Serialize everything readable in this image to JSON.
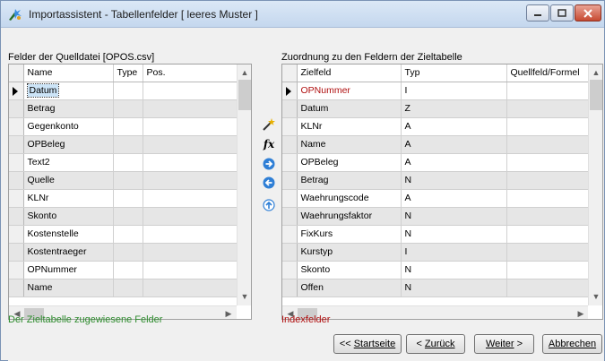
{
  "window": {
    "title": "Importassistent - Tabellenfelder [ leeres Muster ]"
  },
  "source": {
    "label": "Felder der Quelldatei [OPOS.csv]",
    "columns": [
      "Name",
      "Type",
      "Pos."
    ],
    "rows": [
      {
        "name": "Datum",
        "type": "",
        "pos": ""
      },
      {
        "name": "Betrag",
        "type": "",
        "pos": ""
      },
      {
        "name": "Gegenkonto",
        "type": "",
        "pos": ""
      },
      {
        "name": "OPBeleg",
        "type": "",
        "pos": ""
      },
      {
        "name": "Text2",
        "type": "",
        "pos": ""
      },
      {
        "name": "Quelle",
        "type": "",
        "pos": ""
      },
      {
        "name": "KLNr",
        "type": "",
        "pos": ""
      },
      {
        "name": "Skonto",
        "type": "",
        "pos": ""
      },
      {
        "name": "Kostenstelle",
        "type": "",
        "pos": ""
      },
      {
        "name": "Kostentraeger",
        "type": "",
        "pos": ""
      },
      {
        "name": "OPNummer",
        "type": "",
        "pos": ""
      },
      {
        "name": "Name",
        "type": "",
        "pos": ""
      }
    ],
    "legend": "Der Zieltabelle zugewiesene Felder"
  },
  "target": {
    "label": "Zuordnung zu den Feldern der Zieltabelle",
    "columns": [
      "Zielfeld",
      "Typ",
      "Quellfeld/Formel"
    ],
    "rows": [
      {
        "field": "OPNummer",
        "type": "I",
        "source": ""
      },
      {
        "field": "Datum",
        "type": "Z",
        "source": ""
      },
      {
        "field": "KLNr",
        "type": "A",
        "source": ""
      },
      {
        "field": "Name",
        "type": "A",
        "source": ""
      },
      {
        "field": "OPBeleg",
        "type": "A",
        "source": ""
      },
      {
        "field": "Betrag",
        "type": "N",
        "source": ""
      },
      {
        "field": "Waehrungscode",
        "type": "A",
        "source": ""
      },
      {
        "field": "Waehrungsfaktor",
        "type": "N",
        "source": ""
      },
      {
        "field": "FixKurs",
        "type": "N",
        "source": ""
      },
      {
        "field": "Kurstyp",
        "type": "I",
        "source": ""
      },
      {
        "field": "Skonto",
        "type": "N",
        "source": ""
      },
      {
        "field": "Offen",
        "type": "N",
        "source": ""
      }
    ],
    "legend": "Indexfelder"
  },
  "buttons": {
    "start_prefix": "<< ",
    "start_label": "Startseite",
    "back_prefix": "< ",
    "back_label": "Zurück",
    "next_label": "Weiter",
    "next_suffix": " >",
    "cancel_label": "Abbrechen"
  },
  "icons": {
    "title": "importassistant-icon",
    "middle": [
      "magic-wand-icon",
      "formula-fx-icon",
      "arrow-right-icon",
      "arrow-left-icon",
      "arrow-up-icon"
    ]
  },
  "colors": {
    "accent_blue": "#2f7fd6",
    "legend_green": "#2b8a2b",
    "legend_red": "#b01010"
  }
}
